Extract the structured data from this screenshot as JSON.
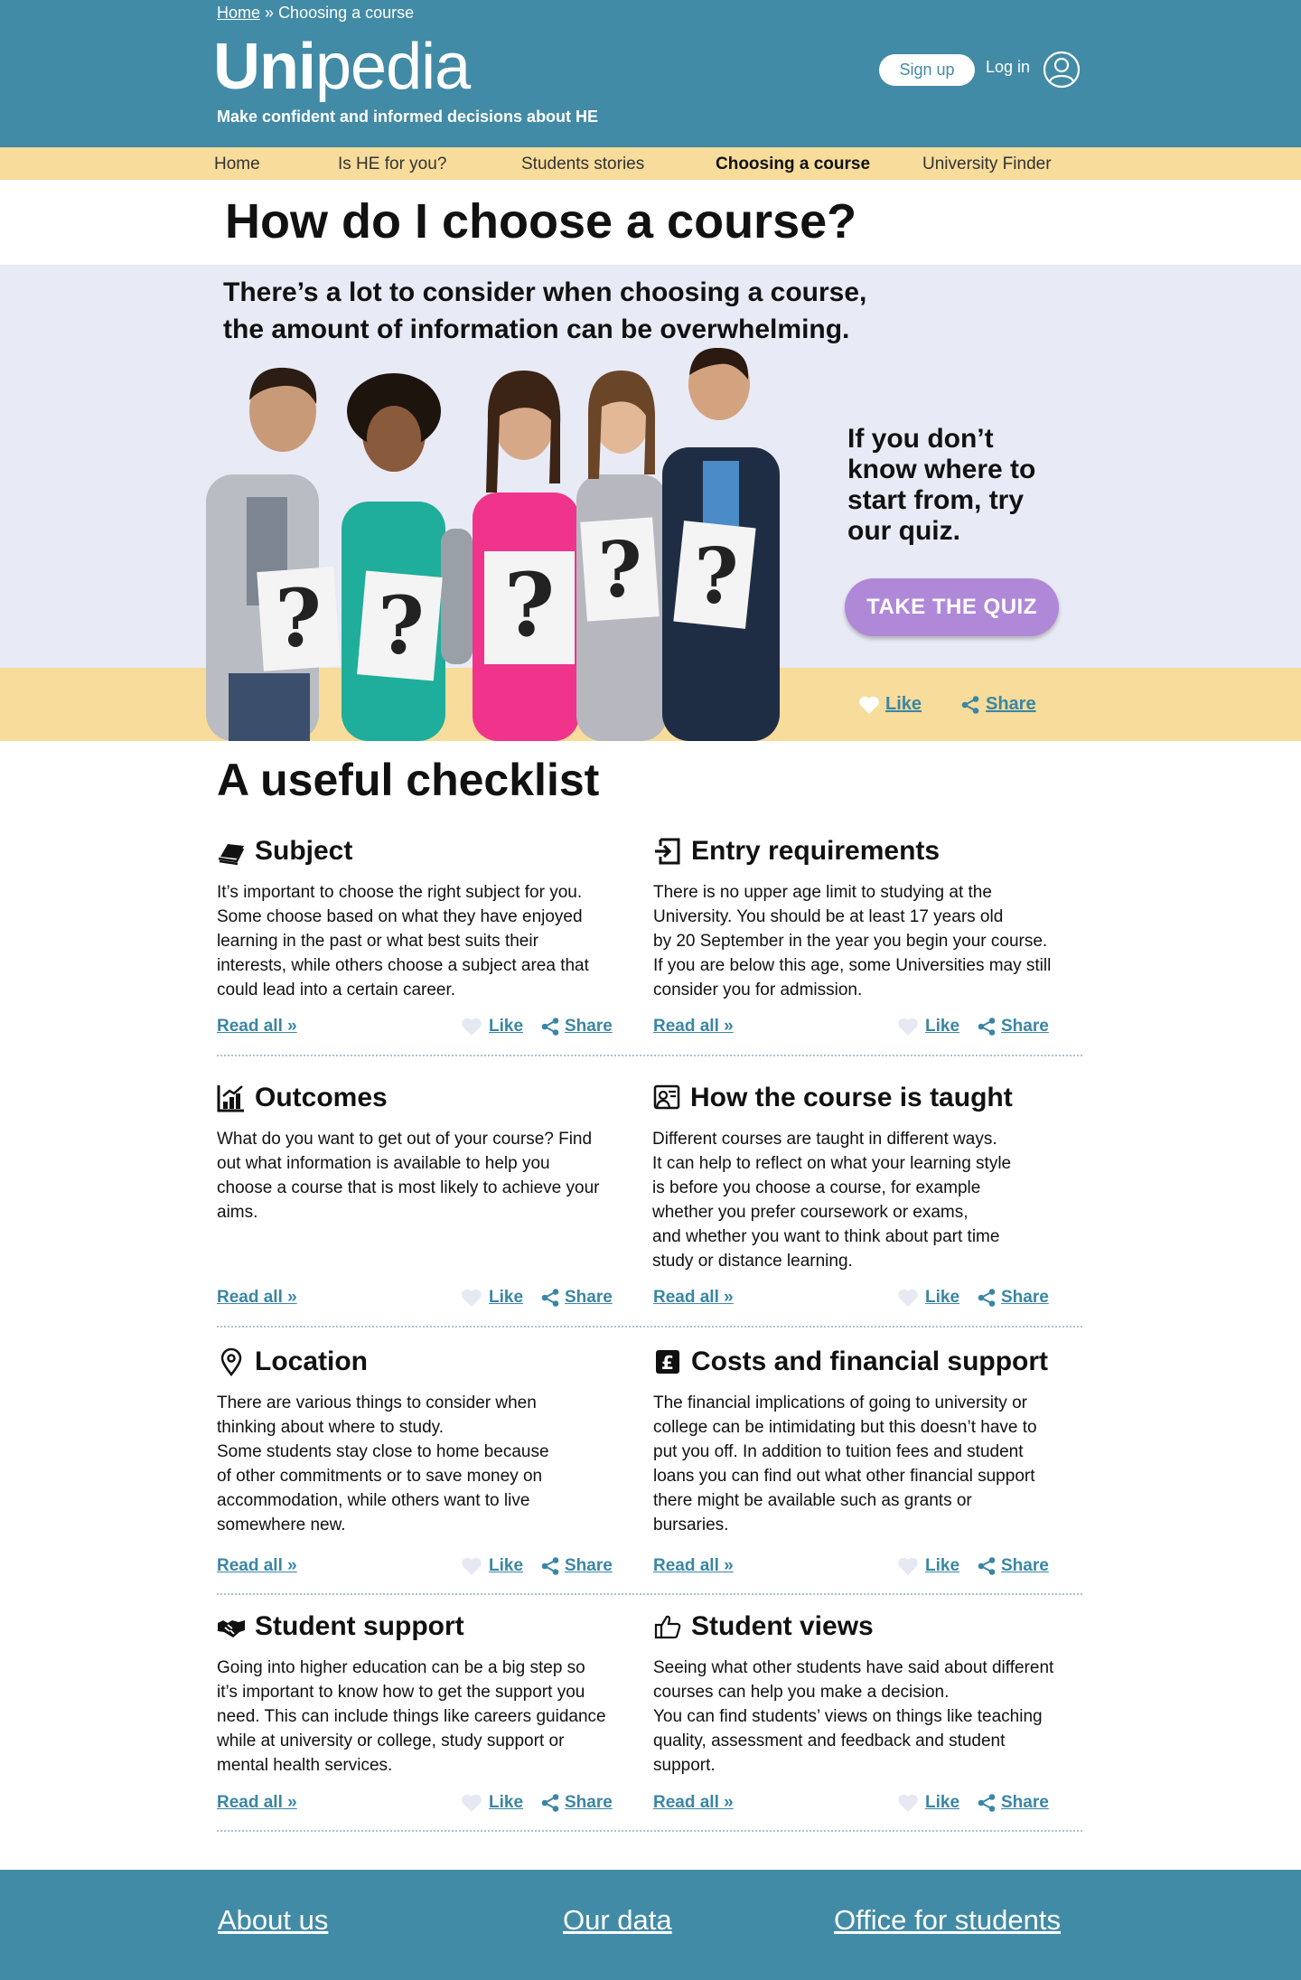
{
  "breadcrumb": {
    "home": "Home",
    "separator": "»",
    "current": "Choosing a course"
  },
  "logo": {
    "bold": "Uni",
    "regular": "pedia"
  },
  "tagline": "Make confident and informed decisions about HE",
  "account": {
    "signup": "Sign up",
    "login": "Log in",
    "icon": "user-icon"
  },
  "nav": [
    {
      "label": "Home",
      "active": false
    },
    {
      "label": "Is HE for you?",
      "active": false
    },
    {
      "label": "Students stories",
      "active": false
    },
    {
      "label": "Choosing a course",
      "active": true
    },
    {
      "label": "University Finder",
      "active": false
    }
  ],
  "page_title": "How do I choose a course?",
  "hero": {
    "intro_line1": "There’s a lot to consider when choosing a course,",
    "intro_line2": "the amount of information can be overwhelming.",
    "quiz_prompt": "If you don’t know where to start from, try our quiz.",
    "quiz_button": "TAKE THE QUIZ",
    "like": "Like",
    "share": "Share"
  },
  "checklist": {
    "title": "A useful checklist",
    "read_all": "Read all »",
    "like": "Like",
    "share": "Share",
    "items": [
      {
        "title": "Subject",
        "icon": "book-icon",
        "text": "It’s important to choose the right subject for you.\nSome choose based on what they have enjoyed\nlearning in the past or what best suits their\ninterests, while others choose a subject area that\ncould lead into a certain career."
      },
      {
        "title": "Entry requirements",
        "icon": "sign-in-icon",
        "text": "There is no upper age limit to studying at the\nUniversity. You should be at least 17 years old\nby 20 September in the year you begin your course.\nIf you are below this age, some Universities may still\nconsider you for admission."
      },
      {
        "title": "Outcomes",
        "icon": "bar-chart-icon",
        "text": "What do you want to get out of your course? Find\nout what information is available to help you\nchoose a course that is most likely to achieve your\naims."
      },
      {
        "title": "How the course is taught",
        "icon": "teacher-icon",
        "text": "Different courses are taught in different ways.\nIt can help to reflect on what your learning style\nis before you choose a course, for example\nwhether you prefer coursework or exams,\nand whether you want to think about part time\nstudy or distance learning."
      },
      {
        "title": "Location",
        "icon": "map-pin-icon",
        "text": "There are various things to consider when\nthinking about where to study.\nSome students stay close to home because\nof other commitments or to save money on\naccommodation, while others want to live\nsomewhere new."
      },
      {
        "title": "Costs and financial support",
        "icon": "pound-icon",
        "text": "The financial implications of going to university or\ncollege can be intimidating but this doesn’t have to\nput you off. In addition to tuition fees and student\nloans you can find out what other financial support\nthere might be available such as grants or\nbursaries."
      },
      {
        "title": "Student support",
        "icon": "handshake-icon",
        "text": "Going into higher education can be a big step so\nit’s important to know how to get the support you\nneed. This can include things like careers guidance\nwhile at university or college, study support or\nmental health services."
      },
      {
        "title": "Student views",
        "icon": "thumbs-up-icon",
        "text": "Seeing what other students have said about different\ncourses can help you make a decision.\nYou can find students’ views on things like teaching\nquality, assessment and feedback and student\nsupport."
      }
    ]
  },
  "footer": {
    "about": "About us",
    "data": "Our data",
    "office": "Office for students"
  },
  "colors": {
    "header": "#428ba6",
    "nav": "#f7dc9b",
    "hero_bg": "#e8eaf5",
    "quiz": "#b088d8",
    "link": "#3a86a4"
  }
}
